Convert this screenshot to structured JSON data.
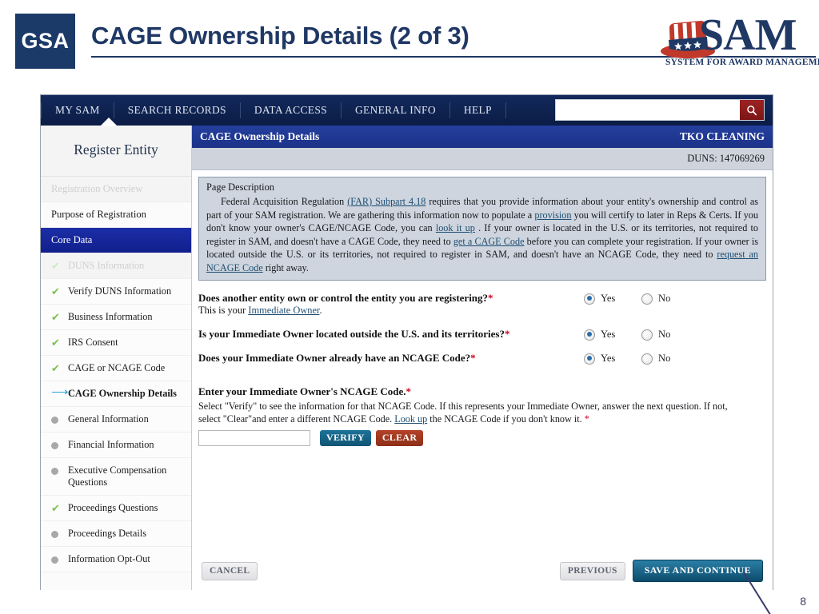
{
  "slide": {
    "logo_text": "GSA",
    "title": "CAGE Ownership Details (2 of 3)",
    "page_number": "8",
    "brand_logo": {
      "word": "SAM",
      "tagline": "SYSTEM FOR AWARD MANAGEMENT"
    },
    "colors": {
      "title_blue": "#1f3864",
      "gsa_navy": "#1b3a68",
      "nav_navy": "#0f2352",
      "header_blue": "#1f3a93",
      "sidebar_active": "#14249b",
      "verify_teal": "#17678c",
      "clear_red": "#a33a22",
      "required_red": "#d0021b",
      "link_blue": "#1d4e73",
      "check_green": "#77c14b"
    }
  },
  "nav": {
    "items": [
      {
        "label": "MY SAM",
        "active": true
      },
      {
        "label": "SEARCH RECORDS",
        "active": false
      },
      {
        "label": "DATA ACCESS",
        "active": false
      },
      {
        "label": "GENERAL INFO",
        "active": false
      },
      {
        "label": "HELP",
        "active": false
      }
    ],
    "search": {
      "value": "",
      "placeholder": "",
      "icon": "search-icon"
    }
  },
  "sidebar": {
    "title": "Register Entity",
    "items": [
      {
        "label": "Registration Overview",
        "type": "section",
        "state": "faded"
      },
      {
        "label": "Purpose of Registration",
        "type": "section",
        "state": "normal"
      },
      {
        "label": "Core Data",
        "type": "section",
        "state": "active"
      },
      {
        "label": "DUNS Information",
        "type": "sub",
        "bullet": "check",
        "state": "faded"
      },
      {
        "label": "Verify DUNS Information",
        "type": "sub",
        "bullet": "check",
        "state": "normal"
      },
      {
        "label": "Business Information",
        "type": "sub",
        "bullet": "check",
        "state": "normal"
      },
      {
        "label": "IRS Consent",
        "type": "sub",
        "bullet": "check",
        "state": "normal"
      },
      {
        "label": "CAGE or NCAGE Code",
        "type": "sub",
        "bullet": "check",
        "state": "normal"
      },
      {
        "label": "CAGE Ownership Details",
        "type": "sub",
        "bullet": "arrow",
        "state": "current"
      },
      {
        "label": "General Information",
        "type": "sub",
        "bullet": "dot",
        "state": "normal"
      },
      {
        "label": "Financial Information",
        "type": "sub",
        "bullet": "dot",
        "state": "normal"
      },
      {
        "label": "Executive Compensation Questions",
        "type": "sub",
        "bullet": "dot",
        "state": "normal"
      },
      {
        "label": "Proceedings Questions",
        "type": "sub",
        "bullet": "check",
        "state": "normal"
      },
      {
        "label": "Proceedings Details",
        "type": "sub",
        "bullet": "dot",
        "state": "normal"
      },
      {
        "label": "Information Opt-Out",
        "type": "sub",
        "bullet": "dot",
        "state": "normal"
      }
    ]
  },
  "content": {
    "header_title": "CAGE Ownership Details",
    "entity_name": "TKO CLEANING",
    "duns_label": "DUNS:",
    "duns_value": "147069269",
    "page_description": {
      "title": "Page Description",
      "text_1": "Federal Acquisition Regulation ",
      "link_1": "(FAR) Subpart 4.18",
      "text_2": " requires that you provide information about your entity's ownership and control as part of your SAM registration. We are gathering this information now to populate a ",
      "link_2": "provision",
      "text_3": " you will certify to later in Reps & Certs. If you don't know your owner's CAGE/NCAGE Code, you can ",
      "link_3": "look it up",
      "text_4": " . If your owner is located in the U.S. or its territories, not required to register in SAM, and doesn't have a CAGE Code, they need to ",
      "link_4": "get a CAGE Code",
      "text_5": " before you can complete your registration. If your owner is located outside the U.S. or its territories, not required to register in SAM, and doesn't have an NCAGE Code, they need to ",
      "link_5": "request an NCAGE Code",
      "text_6": " right away."
    },
    "questions": [
      {
        "main": "Does another entity own or control the entity you are registering?",
        "required_mark": "*",
        "sub_prefix": "This is your ",
        "sub_link": "Immediate Owner",
        "sub_suffix": ".",
        "yes_label": "Yes",
        "no_label": "No",
        "selected": "Yes"
      },
      {
        "main": "Is your Immediate Owner located outside the U.S. and its territories?",
        "required_mark": "*",
        "sub_prefix": "",
        "sub_link": "",
        "sub_suffix": "",
        "yes_label": "Yes",
        "no_label": "No",
        "selected": "Yes"
      },
      {
        "main": "Does your Immediate Owner already have an NCAGE Code?",
        "required_mark": "*",
        "sub_prefix": "",
        "sub_link": "",
        "sub_suffix": "",
        "yes_label": "Yes",
        "no_label": "No",
        "selected": "Yes"
      }
    ],
    "ncage": {
      "title": "Enter your Immediate Owner's NCAGE Code.",
      "required_mark": "*",
      "help_1": "Select \"Verify\" to see the information for that NCAGE Code. If this represents your Immediate Owner, answer the next question. If not, select \"Clear\"and enter a different NCAGE Code.  ",
      "help_link": "Look up",
      "help_2": " the NCAGE Code if you don't know it. ",
      "help_required": "*",
      "input_value": "",
      "input_placeholder": "",
      "verify_label": "VERIFY",
      "clear_label": "CLEAR"
    },
    "footer": {
      "cancel_label": "CANCEL",
      "previous_label": "PREVIOUS",
      "save_label": "SAVE AND CONTINUE"
    }
  }
}
